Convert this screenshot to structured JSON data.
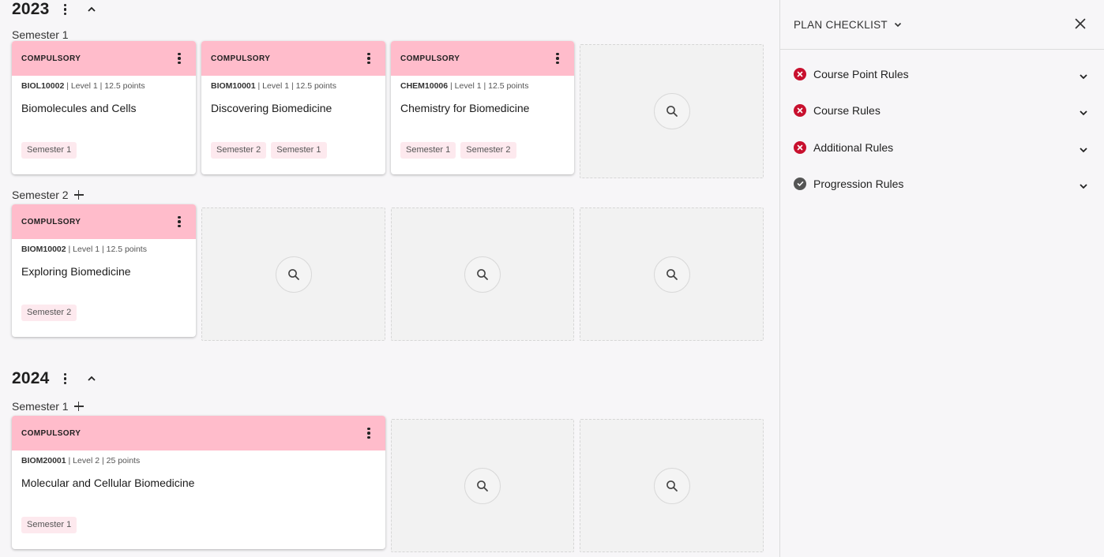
{
  "years": [
    {
      "label": "2023",
      "semesters": [
        {
          "label": "Semester 1",
          "show_add": false,
          "courses": [
            {
              "tag": "COMPULSORY",
              "code": "BIOL10002",
              "meta": " | Level 1 | 12.5 points",
              "title": "Biomolecules and Cells",
              "chips": [
                "Semester 1"
              ]
            },
            {
              "tag": "COMPULSORY",
              "code": "BIOM10001",
              "meta": " | Level 1 | 12.5 points",
              "title": "Discovering Biomedicine",
              "chips": [
                "Semester 2",
                "Semester 1"
              ]
            },
            {
              "tag": "COMPULSORY",
              "code": "CHEM10006",
              "meta": " | Level 1 | 12.5 points",
              "title": "Chemistry for Biomedicine",
              "chips": [
                "Semester 1",
                "Semester 2"
              ]
            }
          ]
        },
        {
          "label": "Semester 2",
          "show_add": true,
          "courses": [
            {
              "tag": "COMPULSORY",
              "code": "BIOM10002",
              "meta": " | Level 1 | 12.5 points",
              "title": "Exploring Biomedicine",
              "chips": [
                "Semester 2"
              ]
            }
          ]
        }
      ]
    },
    {
      "label": "2024",
      "semesters": [
        {
          "label": "Semester 1",
          "show_add": true,
          "courses": [
            {
              "tag": "COMPULSORY",
              "code": "BIOM20001",
              "meta": " | Level 2 | 25 points",
              "title": "Molecular and Cellular Biomedicine",
              "chips": [
                "Semester 1"
              ]
            }
          ]
        }
      ]
    }
  ],
  "checklist": {
    "title": "PLAN CHECKLIST",
    "rules": [
      {
        "label": "Course Point Rules",
        "status": "fail"
      },
      {
        "label": "Course Rules",
        "status": "fail"
      },
      {
        "label": "Additional Rules",
        "status": "fail"
      },
      {
        "label": "Progression Rules",
        "status": "pass"
      }
    ]
  },
  "colors": {
    "card_header": "#ffbccb",
    "chip_bg": "#fde9ee",
    "fail": "#c8102e",
    "pass": "#555555"
  },
  "icons": {
    "empty_slot": "search-icon",
    "year_menu": "kebab-icon",
    "collapse": "chevron-up-icon",
    "add_semester": "plus-icon",
    "close": "close-icon"
  }
}
